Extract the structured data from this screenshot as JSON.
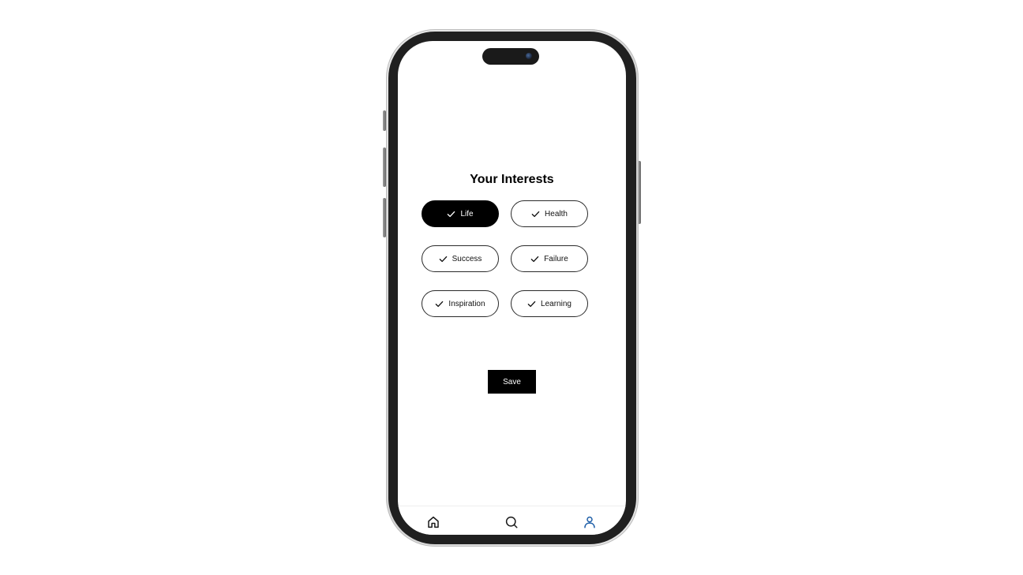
{
  "screen": {
    "title": "Your Interests"
  },
  "interests": [
    {
      "label": "Life",
      "selected": true,
      "icon": "check-icon"
    },
    {
      "label": "Health",
      "selected": false,
      "icon": "check-icon"
    },
    {
      "label": "Success",
      "selected": false,
      "icon": "check-icon"
    },
    {
      "label": "Failure",
      "selected": false,
      "icon": "check-icon"
    },
    {
      "label": "Inspiration",
      "selected": false,
      "icon": "check-icon"
    },
    {
      "label": "Learning",
      "selected": false,
      "icon": "check-icon"
    }
  ],
  "actions": {
    "save_label": "Save"
  },
  "bottom_nav": {
    "items": [
      {
        "icon": "home-icon",
        "active": false
      },
      {
        "icon": "search-icon",
        "active": false
      },
      {
        "icon": "user-icon",
        "active": true
      }
    ]
  },
  "colors": {
    "accent": "#1f5fa8",
    "chip_selected_bg": "#000000",
    "button_bg": "#000000"
  }
}
